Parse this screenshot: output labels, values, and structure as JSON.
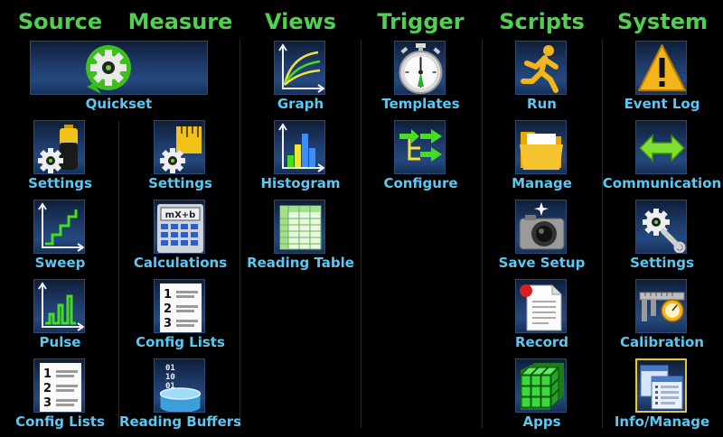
{
  "headers": {
    "source": "Source",
    "measure": "Measure",
    "views": "Views",
    "trigger": "Trigger",
    "scripts": "Scripts",
    "system": "System"
  },
  "source": {
    "quickset": "Quickset",
    "settings": "Settings",
    "sweep": "Sweep",
    "pulse": "Pulse",
    "config_lists": "Config Lists"
  },
  "measure": {
    "settings": "Settings",
    "calculations": "Calculations",
    "config_lists": "Config Lists",
    "reading_buffers": "Reading Buffers"
  },
  "views": {
    "graph": "Graph",
    "histogram": "Histogram",
    "reading_table": "Reading Table"
  },
  "trigger": {
    "templates": "Templates",
    "configure": "Configure"
  },
  "scripts": {
    "run": "Run",
    "manage": "Manage",
    "save_setup": "Save Setup",
    "record": "Record",
    "apps": "Apps"
  },
  "system": {
    "event_log": "Event Log",
    "communication": "Communication",
    "settings": "Settings",
    "calibration": "Calibration",
    "info_manage": "Info/Manage"
  },
  "icons": {
    "calculations_display": "mX+b",
    "config_list_numbers": [
      "1",
      "2",
      "3"
    ],
    "buffer_bits": [
      "01",
      "10",
      "01"
    ]
  },
  "colors": {
    "header": "#4fd04f",
    "label": "#59c8f2",
    "selected_border": "#e8c733"
  }
}
